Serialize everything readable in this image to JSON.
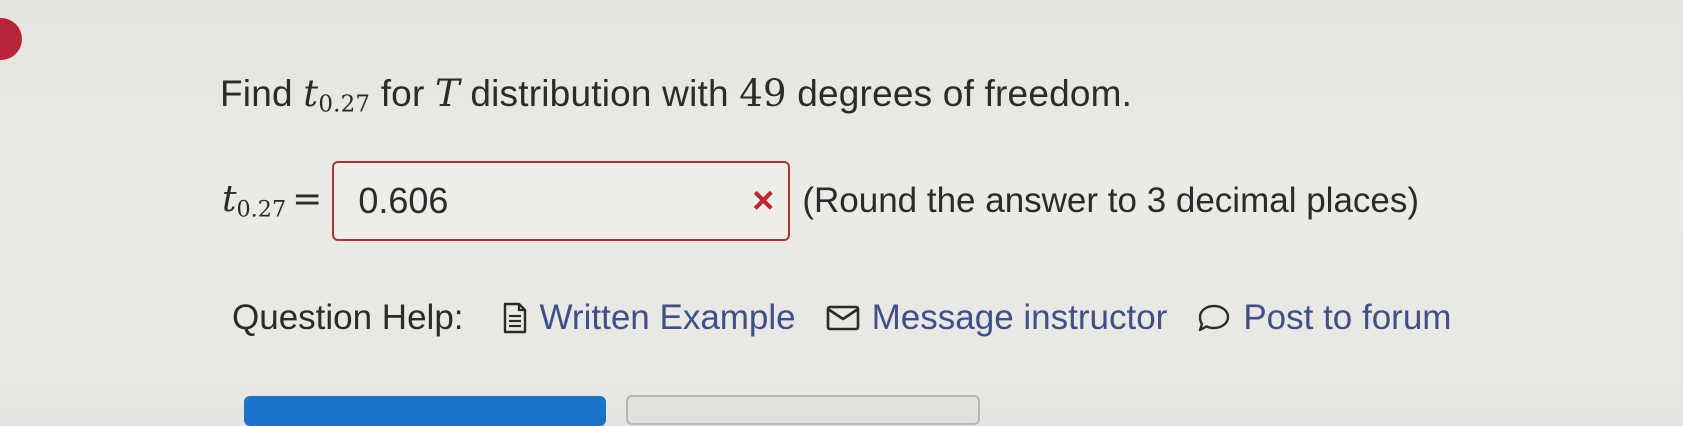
{
  "question": {
    "prefix": "Find",
    "var": "t",
    "subscript": "0.27",
    "mid": "for",
    "dist_var": "T",
    "dist_text": "distribution with",
    "df": "49",
    "suffix": "degrees of freedom."
  },
  "answer": {
    "var": "t",
    "subscript": "0.27",
    "equals": "=",
    "value": "0.606",
    "status_icon": "×",
    "hint": "(Round the answer to 3 decimal places)"
  },
  "help": {
    "label": "Question Help:",
    "links": [
      {
        "label": "Written Example",
        "icon": "document-icon"
      },
      {
        "label": "Message instructor",
        "icon": "envelope-icon"
      },
      {
        "label": "Post to forum",
        "icon": "speech-bubble-icon"
      }
    ]
  },
  "colors": {
    "link": "#3f4f88",
    "error": "#c0262f",
    "primary_button": "#1b74c9"
  }
}
